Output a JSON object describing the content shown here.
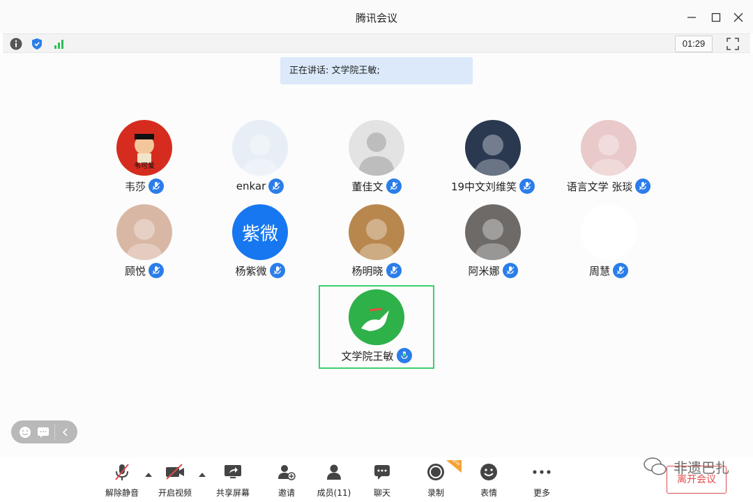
{
  "window": {
    "title": "腾讯会议"
  },
  "infobar": {
    "timer": "01:29"
  },
  "speaking": {
    "text": "正在讲话: 文学院王敏;"
  },
  "members": [
    {
      "name": "韦莎",
      "avatar_color": "#d52c1f",
      "avatar_label": "韦可爱"
    },
    {
      "name": "enkar",
      "avatar_color": "#e7eef6",
      "avatar_label": ""
    },
    {
      "name": "董佳文",
      "avatar_color": "#e3e3e3",
      "avatar_label": ""
    },
    {
      "name": "19中文刘维笑",
      "avatar_color": "#2a3850",
      "avatar_label": ""
    },
    {
      "name": "语言文学  张琰",
      "avatar_color": "#e9c9c9",
      "avatar_label": ""
    },
    {
      "name": "顾悦",
      "avatar_color": "#d9b7a5",
      "avatar_label": ""
    },
    {
      "name": "杨紫微",
      "avatar_color": "#1677f0",
      "avatar_label": "紫微"
    },
    {
      "name": "杨明晓",
      "avatar_color": "#b8874e",
      "avatar_label": ""
    },
    {
      "name": "阿米娜",
      "avatar_color": "#6e6a68",
      "avatar_label": ""
    },
    {
      "name": "周慧",
      "avatar_color": "#ffffff",
      "avatar_label": ""
    },
    {
      "name": "文学院王敏",
      "avatar_color": "#28a745",
      "avatar_label": ""
    }
  ],
  "toolbar": {
    "mute": "解除静音",
    "video": "开启视频",
    "share": "共享屏幕",
    "invite": "邀请",
    "members": "成员(11)",
    "chat": "聊天",
    "record": "录制",
    "record_badge": "NEW",
    "emoji": "表情",
    "more": "更多",
    "leave": "离开会议"
  },
  "watermark": {
    "text": "非遗巴扎"
  },
  "colors": {
    "accent": "#2b7de9",
    "active": "#3ccf6c",
    "danger": "#e24c4c"
  }
}
